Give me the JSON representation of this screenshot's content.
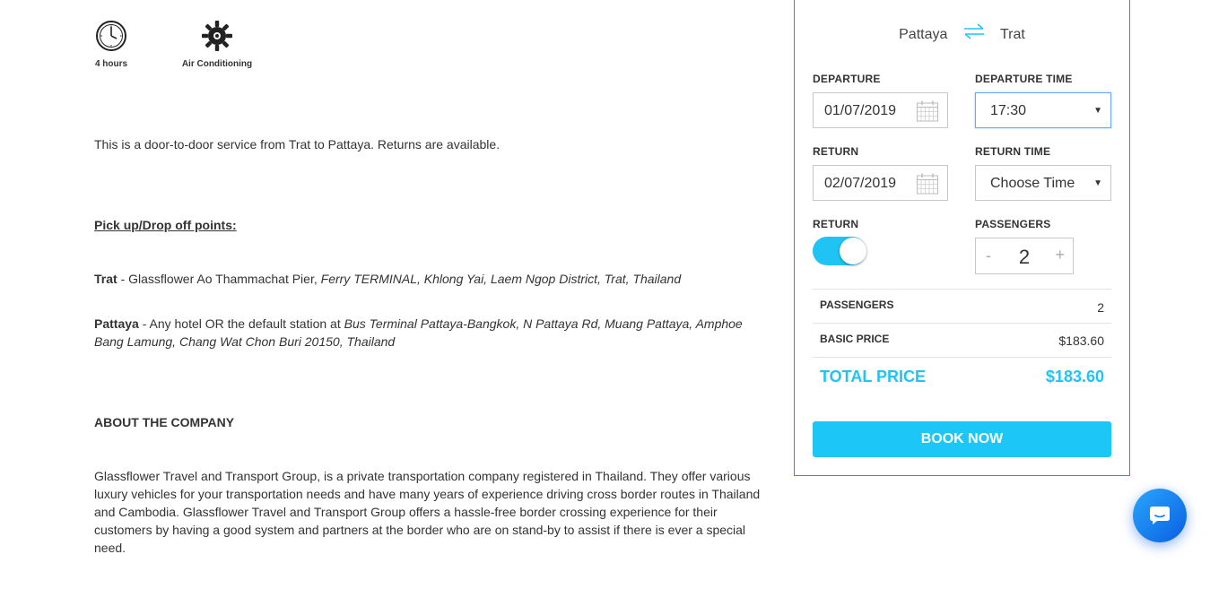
{
  "features": [
    {
      "icon": "clock-icon",
      "caption": "4 hours"
    },
    {
      "icon": "snowflake-icon",
      "caption": "Air Conditioning"
    }
  ],
  "description": "This is a door-to-door service from Trat to Pattaya. Returns are available.",
  "pickup": {
    "heading": "Pick up/Drop off points:",
    "points": [
      {
        "name": "Trat",
        "sep": " - Glassflower Ao Thammachat Pier, ",
        "address": "Ferry TERMINAL, Khlong Yai, Laem Ngop District, Trat, Thailand"
      },
      {
        "name": "Pattaya",
        "sep": " - Any hotel OR the default station at ",
        "address": "Bus Terminal Pattaya-Bangkok, N Pattaya Rd, Muang Pattaya, Amphoe Bang Lamung, Chang Wat Chon Buri 20150, Thailand"
      }
    ]
  },
  "about": {
    "heading": "ABOUT THE COMPANY",
    "text": "Glassflower Travel and Transport Group, is a private transportation company registered in Thailand. They offer various luxury vehicles for your transportation needs and have many years of experience driving cross border routes in Thailand and Cambodia. Glassflower Travel and Transport Group offers a hassle-free border crossing experience for their customers by having a good system and partners at the border who are on stand-by to assist if there is ever a special need."
  },
  "booking": {
    "from": "Pattaya",
    "to": "Trat",
    "departure_label": "DEPARTURE",
    "departure_date": "01/07/2019",
    "departure_time_label": "DEPARTURE TIME",
    "departure_time": "17:30",
    "return_label": "RETURN",
    "return_date": "02/07/2019",
    "return_time_label": "RETURN TIME",
    "return_time": "Choose Time",
    "return_toggle_label": "RETURN",
    "return_toggle_on": true,
    "passengers_label": "PASSENGERS",
    "minus": "-",
    "plus": "+",
    "passengers": "2",
    "summary": {
      "passengers_label": "PASSENGERS",
      "passengers_value": "2",
      "basic_label": "BASIC PRICE",
      "basic_value": "$183.60",
      "total_label": "TOTAL PRICE",
      "total_value": "$183.60"
    },
    "book_label": "BOOK NOW",
    "accent": "#1cc7f8",
    "border": "#d9534f"
  },
  "chat": {
    "icon": "chat-bubble-icon"
  }
}
